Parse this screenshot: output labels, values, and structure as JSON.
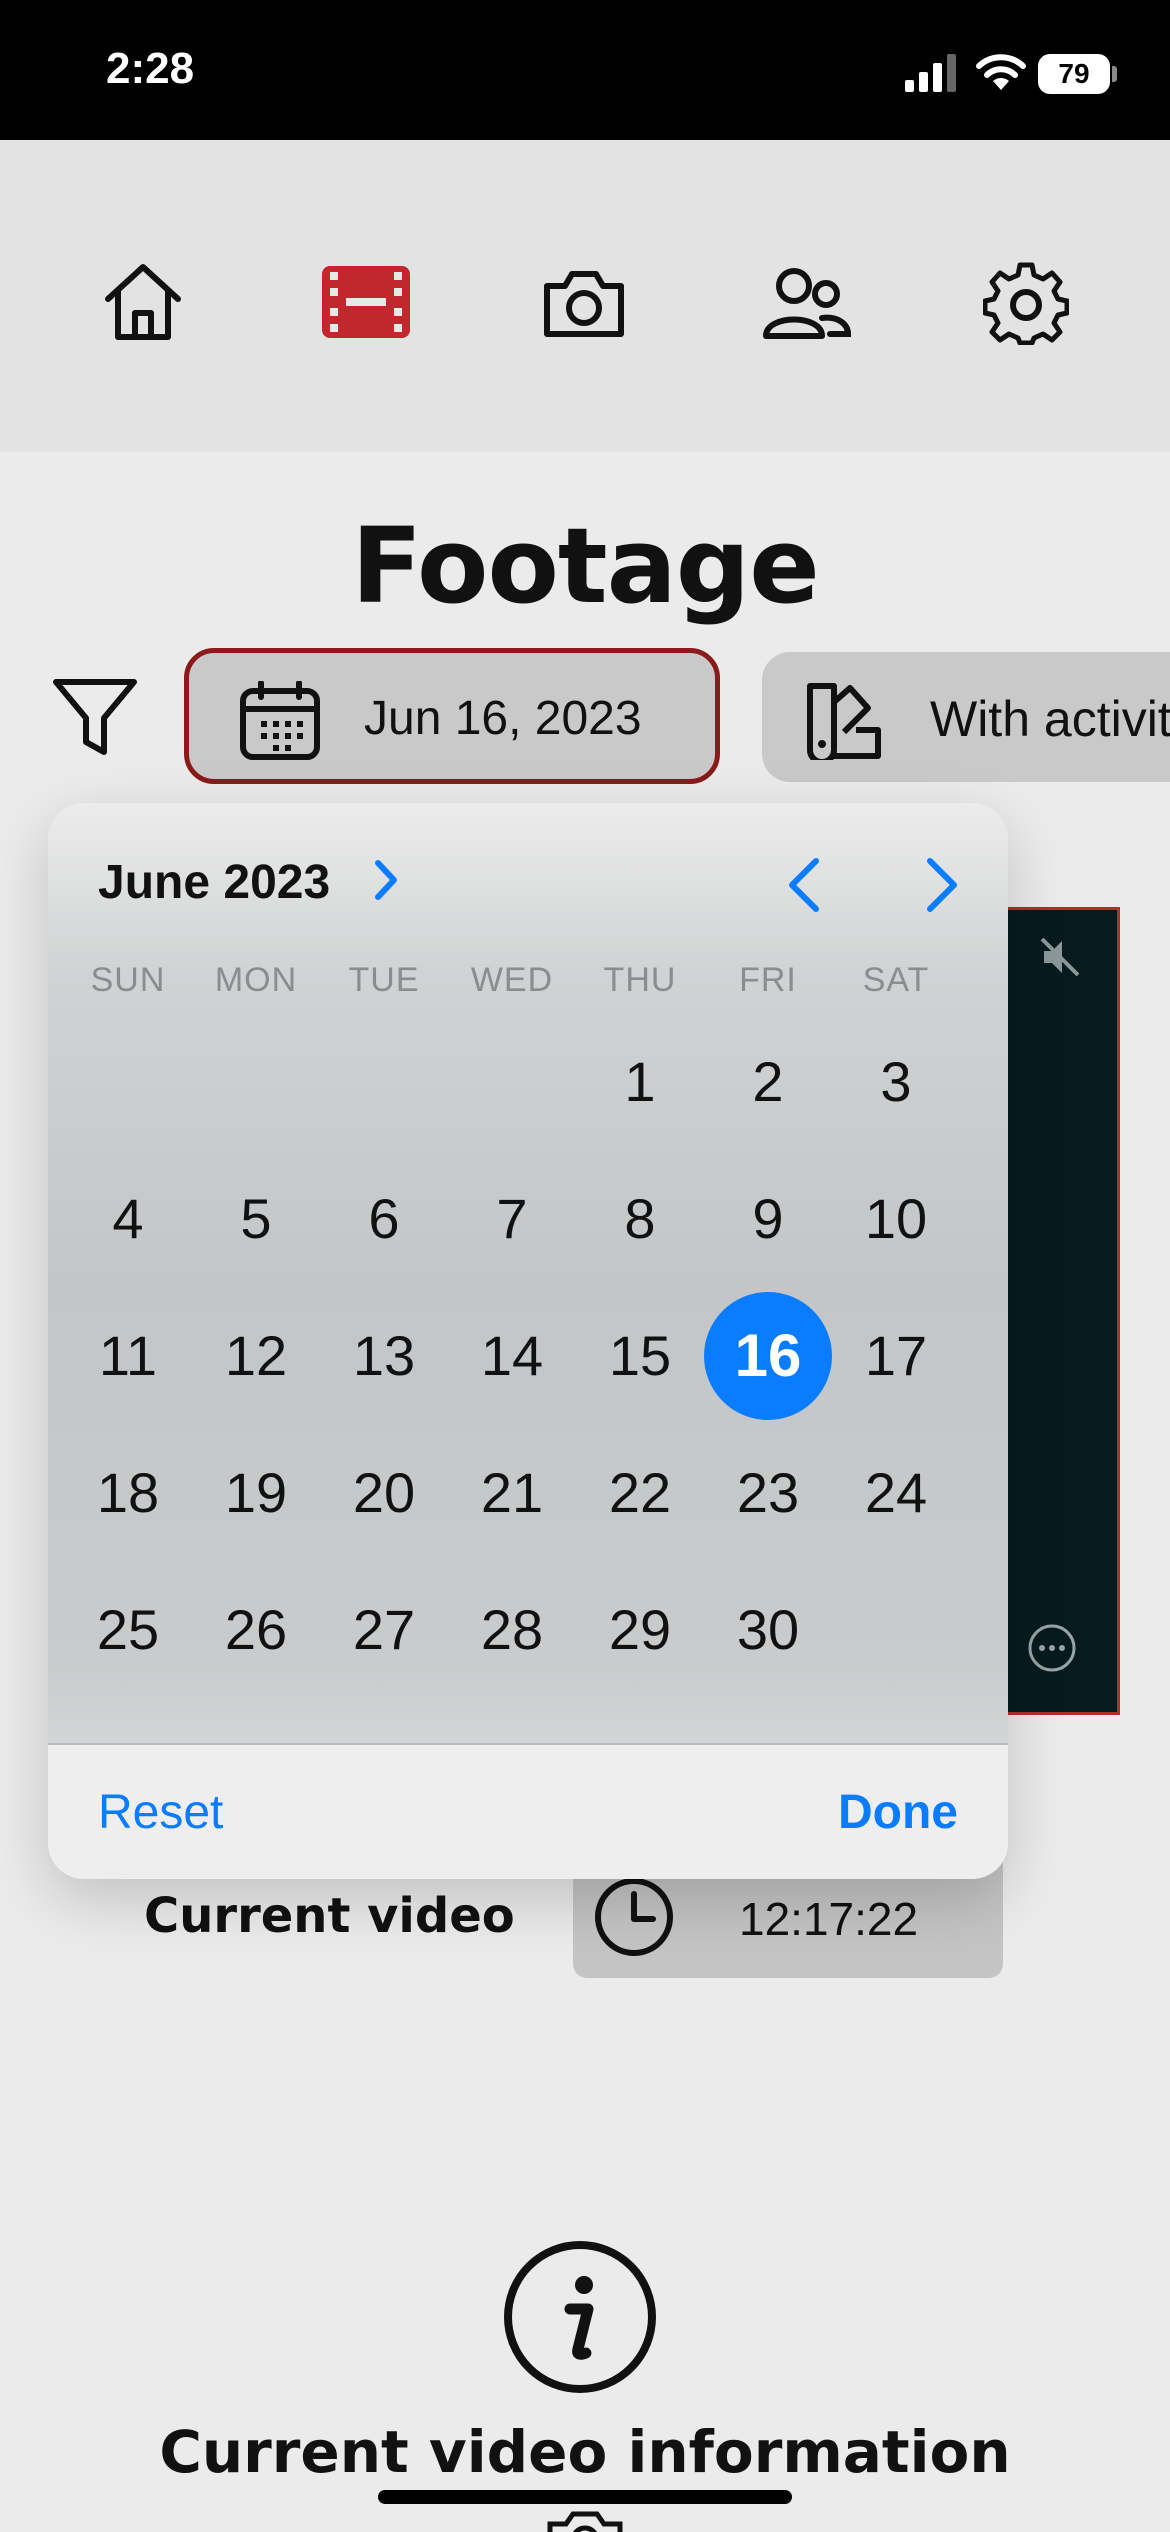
{
  "status_bar": {
    "time": "2:28",
    "battery": "79"
  },
  "nav": {
    "items": [
      {
        "name": "home",
        "icon": "home-icon",
        "active": false
      },
      {
        "name": "footage",
        "icon": "film-icon",
        "active": true
      },
      {
        "name": "camera",
        "icon": "camera-icon",
        "active": false
      },
      {
        "name": "users",
        "icon": "users-icon",
        "active": false
      },
      {
        "name": "settings",
        "icon": "gear-icon",
        "active": false
      }
    ],
    "active_color": "#c2272d"
  },
  "page": {
    "title": "Footage"
  },
  "filters": {
    "date_label": "Jun 16, 2023",
    "activity_label": "With activity"
  },
  "calendar": {
    "month_title": "June 2023",
    "weekdays": [
      "SUN",
      "MON",
      "TUE",
      "WED",
      "THU",
      "FRI",
      "SAT"
    ],
    "leading_blanks": 4,
    "days": [
      "1",
      "2",
      "3",
      "4",
      "5",
      "6",
      "7",
      "8",
      "9",
      "10",
      "11",
      "12",
      "13",
      "14",
      "15",
      "16",
      "17",
      "18",
      "19",
      "20",
      "21",
      "22",
      "23",
      "24",
      "25",
      "26",
      "27",
      "28",
      "29",
      "30"
    ],
    "selected_day": "16",
    "accent_color": "#0a7cff",
    "reset_label": "Reset",
    "done_label": "Done"
  },
  "current_video": {
    "label": "Current video",
    "time": "12:17:22"
  },
  "info": {
    "title": "Current video information"
  }
}
